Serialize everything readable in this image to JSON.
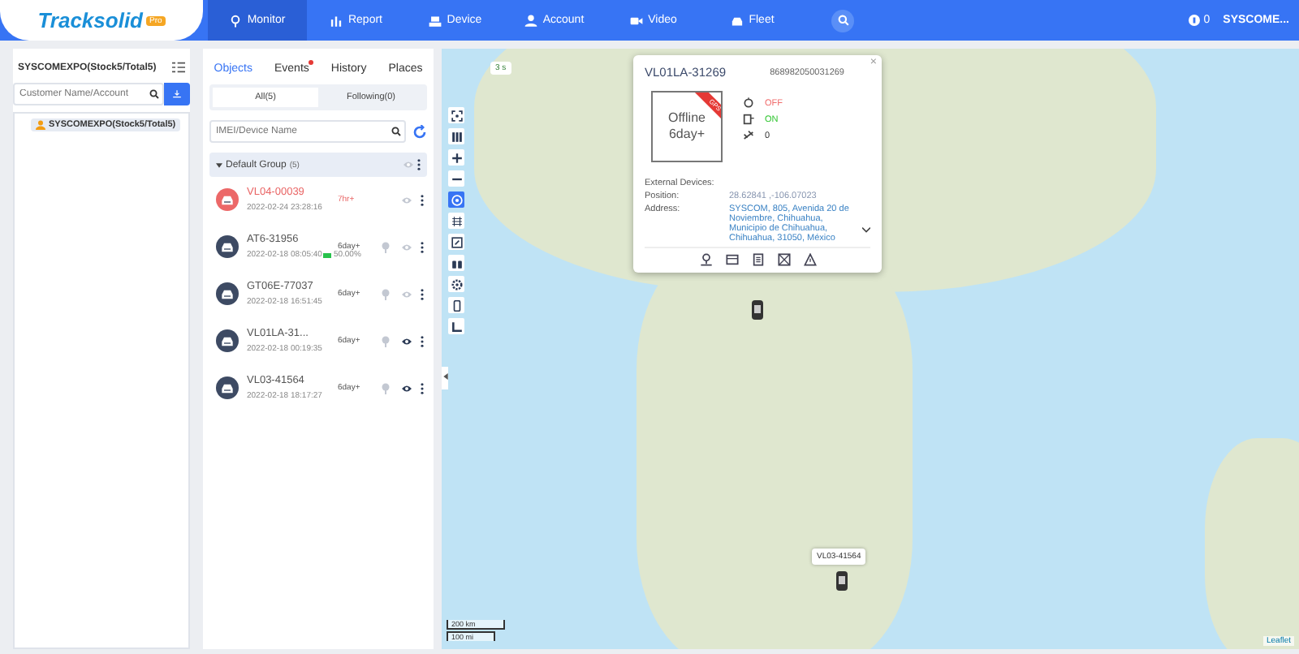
{
  "nav": {
    "logo": "Tracksolid",
    "logo_badge": "Pro",
    "items": [
      {
        "label": "Monitor",
        "selected": true
      },
      {
        "label": "Report",
        "selected": false
      },
      {
        "label": "Device",
        "selected": false
      },
      {
        "label": "Account",
        "selected": false
      },
      {
        "label": "Video",
        "selected": false
      },
      {
        "label": "Fleet",
        "selected": false
      }
    ],
    "coins": "0",
    "user": "SYSCOME..."
  },
  "customers": {
    "title": "SYSCOMEXPO(Stock5/Total5)",
    "search_placeholder": "Customer Name/Account",
    "tree": [
      {
        "label": "SYSCOMEXPO(Stock5/Total5)",
        "selected": true
      }
    ]
  },
  "objects": {
    "tabs": [
      {
        "label": "Objects",
        "selected": true,
        "dot": false
      },
      {
        "label": "Events",
        "selected": false,
        "dot": true
      },
      {
        "label": "History",
        "selected": false,
        "dot": false
      },
      {
        "label": "Places",
        "selected": false,
        "dot": false
      }
    ],
    "subtabs": [
      {
        "label": "All(5)",
        "selected": true
      },
      {
        "label": "Following(0)",
        "selected": false
      }
    ],
    "search_placeholder": "IMEI/Device Name",
    "group": {
      "name": "Default Group",
      "count": "(5)",
      "expanded": true
    },
    "devices": [
      {
        "name": "VL04-00039",
        "time": "2022-02-24 23:28:16",
        "duration": "7hr+",
        "alert": true,
        "pin": false,
        "followed": false
      },
      {
        "name": "AT6-31956",
        "time": "2022-02-18 08:05:40",
        "battery": "50.00%",
        "duration": "6day+",
        "alert": false,
        "pin": true,
        "followed": false
      },
      {
        "name": "GT06E-77037",
        "time": "2022-02-18 16:51:45",
        "duration": "6day+",
        "alert": false,
        "pin": true,
        "followed": false
      },
      {
        "name": "VL01LA-31...",
        "time": "2022-02-18 00:19:35",
        "duration": "6day+",
        "alert": false,
        "pin": true,
        "followed": true
      },
      {
        "name": "VL03-41564",
        "time": "2022-02-18 18:17:27",
        "duration": "6day+",
        "alert": false,
        "pin": true,
        "followed": true
      }
    ]
  },
  "map": {
    "refresh": "3 s",
    "controls": [
      {
        "selected": false
      },
      {
        "selected": false
      },
      {
        "selected": false
      },
      {
        "selected": false
      },
      {
        "selected": true
      },
      {
        "selected": false
      },
      {
        "selected": false
      },
      {
        "selected": false
      },
      {
        "selected": false
      },
      {
        "selected": false
      },
      {
        "selected": false
      }
    ],
    "marker_label": "VL03-41564",
    "scale_km": "200 km",
    "scale_mi": "100 mi",
    "attribution": "Leaflet",
    "popup": {
      "close": "×",
      "title": "VL01LA-31269",
      "imei": "868982050031269",
      "status": "Offline",
      "duration": "6day+",
      "ribbon": "GPS",
      "rows": [
        {
          "kind": "acc",
          "value": "OFF",
          "on": false
        },
        {
          "kind": "power",
          "value": "ON",
          "on": true
        },
        {
          "kind": "count",
          "value": "0"
        }
      ],
      "external_label": "External Devices:",
      "position_label": "Position:",
      "position": "28.62841 ,-106.07023",
      "address_label": "Address:",
      "address": "SYSCOM, 805, Avenida 20 de Noviembre, Chihuahua, Municipio de Chihuahua, Chihuahua, 31050, México"
    }
  }
}
